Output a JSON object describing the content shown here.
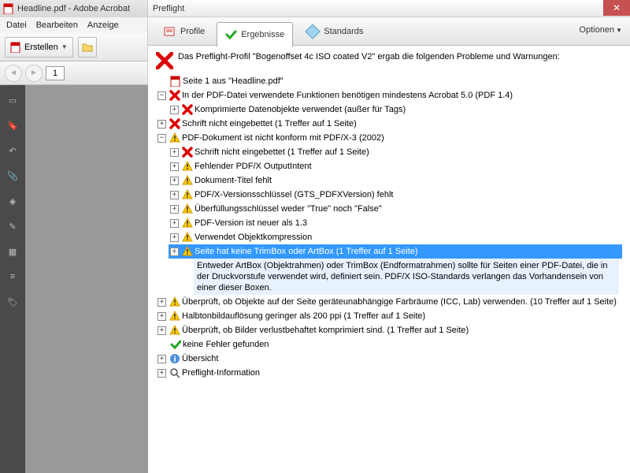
{
  "acrobat": {
    "title": "Headline.pdf - Adobe Acrobat",
    "menu": [
      "Datei",
      "Bearbeiten",
      "Anzeige"
    ],
    "create_btn": "Erstellen",
    "page_num": "1"
  },
  "preflight": {
    "title": "Preflight",
    "tabs": {
      "profile": "Profile",
      "results": "Ergebnisse",
      "standards": "Standards"
    },
    "options": "Optionen",
    "summary": "Das Preflight-Profil \"Bogenoffset 4c ISO coated V2\" ergab die folgenden Probleme und Warnungen:",
    "tree": {
      "page_info": "Seite 1 aus \"Headline.pdf\"",
      "acrobat5": "In der PDF-Datei verwendete Funktionen benötigen mindestens Acrobat 5.0 (PDF 1.4)",
      "compressed": "Komprimierte Datenobjekte verwendet (außer für Tags)",
      "font_not_embedded1": "Schrift nicht eingebettet (1 Treffer auf 1 Seite)",
      "not_conform": "PDF-Dokument ist nicht konform mit PDF/X-3 (2002)",
      "font_not_embedded2": "Schrift nicht eingebettet (1 Treffer auf 1 Seite)",
      "missing_oi": "Fehlender PDF/X OutputIntent",
      "title_missing": "Dokument-Titel fehlt",
      "version_key": "PDF/X-Versionsschlüssel (GTS_PDFXVersion) fehlt",
      "trapping": "Überfüllungsschlüssel weder \"True\" noch \"False\"",
      "pdfver": "PDF-Version ist neuer als 1.3",
      "objcomp": "Verwendet Objektkompression",
      "trimbox": "Seite hat keine TrimBox oder ArtBox (1 Treffer auf 1 Seite)",
      "trimbox_detail": "Entweder ArtBox (Objektrahmen) oder TrimBox (Endformatrahmen) sollte für Seiten einer PDF-Datei, die in der Druckvorstufe verwendet wird, definiert sein. PDF/X ISO-Standards verlangen das Vorhandensein von einer dieser Boxen.",
      "icc": "Überprüft, ob Objekte auf der Seite geräteunabhängige Farbräume (ICC, Lab) verwenden. (10 Treffer auf 1 Seite)",
      "halftone": "Halbtonbildauflösung geringer als 200 ppi (1 Treffer auf 1 Seite)",
      "lossy": "Überprüft, ob Bilder verlustbehaftet komprimiert sind. (1 Treffer auf 1 Seite)",
      "no_errors": "keine Fehler gefunden",
      "overview": "Übersicht",
      "pf_info": "Preflight-Information"
    }
  }
}
